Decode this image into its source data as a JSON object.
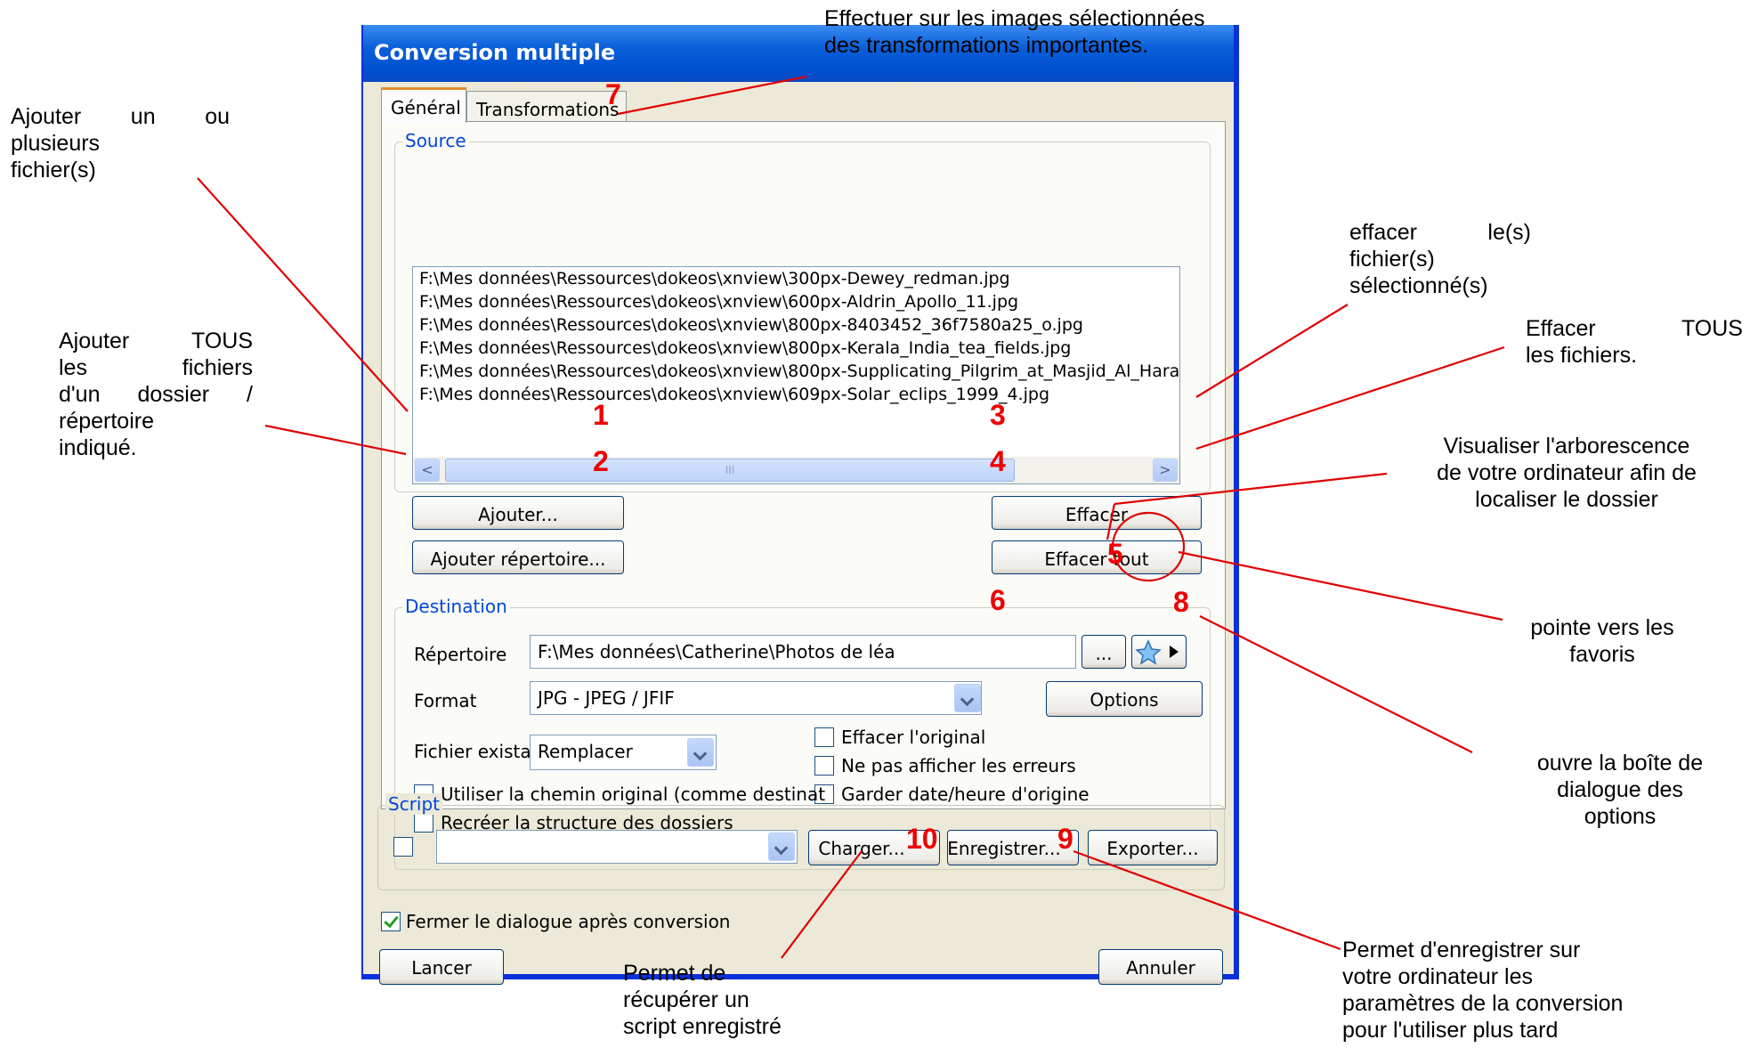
{
  "dialog": {
    "title": "Conversion multiple",
    "tabs": [
      {
        "label": "Général",
        "selected": true
      },
      {
        "label": "Transformations",
        "selected": false
      }
    ],
    "source": {
      "group_label": "Source",
      "files": [
        "F:\\Mes données\\Ressources\\dokeos\\xnview\\300px-Dewey_redman.jpg",
        "F:\\Mes données\\Ressources\\dokeos\\xnview\\600px-Aldrin_Apollo_11.jpg",
        "F:\\Mes données\\Ressources\\dokeos\\xnview\\800px-8403452_36f7580a25_o.jpg",
        "F:\\Mes données\\Ressources\\dokeos\\xnview\\800px-Kerala_India_tea_fields.jpg",
        "F:\\Mes données\\Ressources\\dokeos\\xnview\\800px-Supplicating_Pilgrim_at_Masjid_Al_Hara",
        "F:\\Mes données\\Ressources\\dokeos\\xnview\\609px-Solar_eclips_1999_4.jpg"
      ],
      "scroll_left": "<",
      "scroll_right": ">",
      "scroll_grip": "III",
      "add_button": "Ajouter...",
      "add_folder_button": "Ajouter répertoire...",
      "delete_button": "Effacer",
      "delete_all_button": "Effacer tout"
    },
    "destination": {
      "group_label": "Destination",
      "folder_label": "Répertoire",
      "folder_value": "F:\\Mes données\\Catherine\\Photos de léa",
      "browse_button": "...",
      "format_label": "Format",
      "format_value": "JPG - JPEG / JFIF",
      "options_button": "Options",
      "existing_label": "Fichier existant",
      "existing_value": "Remplacer",
      "checkboxes": [
        {
          "label": "Effacer l'original",
          "checked": false
        },
        {
          "label": "Ne pas afficher les erreurs",
          "checked": false
        },
        {
          "label": "Garder date/heure d'origine",
          "checked": false
        },
        {
          "label": "Utiliser la chemin original (comme destinat",
          "checked": false
        },
        {
          "label": "Recréer la structure des dossiers",
          "checked": false
        }
      ]
    },
    "script": {
      "group_label": "Script",
      "enabled": false,
      "value": "",
      "load_button": "Charger...",
      "save_button": "Enregistrer...",
      "export_button": "Exporter..."
    },
    "close_after": {
      "label": "Fermer le dialogue après conversion",
      "checked": true
    },
    "launch_button": "Lancer",
    "cancel_button": "Annuler"
  },
  "markers": [
    "1",
    "2",
    "3",
    "4",
    "5",
    "6",
    "7",
    "8",
    "9",
    "10"
  ],
  "annotations": {
    "transformations": [
      "Effectuer sur les images sélectionnées",
      "des transformations importantes."
    ],
    "add_files": [
      "Ajouter un ou",
      "plusieurs",
      "fichier(s)"
    ],
    "add_folder": [
      "Ajouter TOUS",
      "les fichiers",
      "d'un dossier /",
      "répertoire",
      "indiqué."
    ],
    "delete_selected": [
      "effacer le(s)",
      "fichier(s)",
      "sélectionné(s)"
    ],
    "delete_all": [
      "Effacer TOUS",
      "les fichiers."
    ],
    "browse_tree": [
      "Visualiser l'arborescence",
      "de votre ordinateur afin de",
      "localiser le dossier"
    ],
    "favorites": [
      "pointe vers les",
      "favoris"
    ],
    "options": [
      "ouvre la boîte de",
      "dialogue des",
      "options"
    ],
    "save": [
      "Permet d'enregistrer sur",
      "votre ordinateur les",
      "paramètres de la conversion",
      "pour l'utiliser plus tard"
    ],
    "load": [
      "Permet de",
      "récupérer un",
      "script enregistré"
    ]
  },
  "colors": {
    "annotation_line": "#e00000",
    "titlebar": "#0a5fd8",
    "group_label": "#0046d5",
    "dialog_bg": "#ece9d8"
  }
}
